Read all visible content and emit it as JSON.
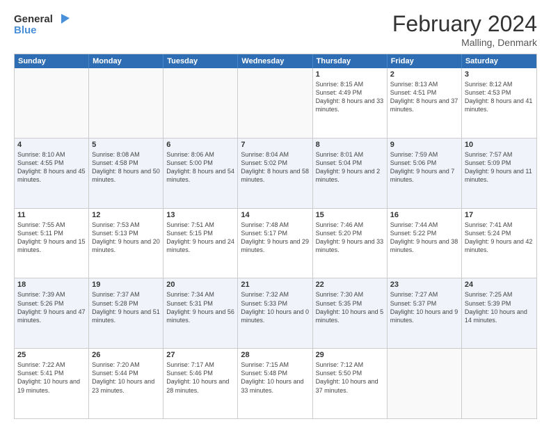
{
  "header": {
    "logo_line1": "General",
    "logo_line2": "Blue",
    "title": "February 2024",
    "subtitle": "Malling, Denmark"
  },
  "days_of_week": [
    "Sunday",
    "Monday",
    "Tuesday",
    "Wednesday",
    "Thursday",
    "Friday",
    "Saturday"
  ],
  "rows": [
    [
      {
        "day": "",
        "sunrise": "",
        "sunset": "",
        "daylight": ""
      },
      {
        "day": "",
        "sunrise": "",
        "sunset": "",
        "daylight": ""
      },
      {
        "day": "",
        "sunrise": "",
        "sunset": "",
        "daylight": ""
      },
      {
        "day": "",
        "sunrise": "",
        "sunset": "",
        "daylight": ""
      },
      {
        "day": "1",
        "sunrise": "Sunrise: 8:15 AM",
        "sunset": "Sunset: 4:49 PM",
        "daylight": "Daylight: 8 hours and 33 minutes."
      },
      {
        "day": "2",
        "sunrise": "Sunrise: 8:13 AM",
        "sunset": "Sunset: 4:51 PM",
        "daylight": "Daylight: 8 hours and 37 minutes."
      },
      {
        "day": "3",
        "sunrise": "Sunrise: 8:12 AM",
        "sunset": "Sunset: 4:53 PM",
        "daylight": "Daylight: 8 hours and 41 minutes."
      }
    ],
    [
      {
        "day": "4",
        "sunrise": "Sunrise: 8:10 AM",
        "sunset": "Sunset: 4:55 PM",
        "daylight": "Daylight: 8 hours and 45 minutes."
      },
      {
        "day": "5",
        "sunrise": "Sunrise: 8:08 AM",
        "sunset": "Sunset: 4:58 PM",
        "daylight": "Daylight: 8 hours and 50 minutes."
      },
      {
        "day": "6",
        "sunrise": "Sunrise: 8:06 AM",
        "sunset": "Sunset: 5:00 PM",
        "daylight": "Daylight: 8 hours and 54 minutes."
      },
      {
        "day": "7",
        "sunrise": "Sunrise: 8:04 AM",
        "sunset": "Sunset: 5:02 PM",
        "daylight": "Daylight: 8 hours and 58 minutes."
      },
      {
        "day": "8",
        "sunrise": "Sunrise: 8:01 AM",
        "sunset": "Sunset: 5:04 PM",
        "daylight": "Daylight: 9 hours and 2 minutes."
      },
      {
        "day": "9",
        "sunrise": "Sunrise: 7:59 AM",
        "sunset": "Sunset: 5:06 PM",
        "daylight": "Daylight: 9 hours and 7 minutes."
      },
      {
        "day": "10",
        "sunrise": "Sunrise: 7:57 AM",
        "sunset": "Sunset: 5:09 PM",
        "daylight": "Daylight: 9 hours and 11 minutes."
      }
    ],
    [
      {
        "day": "11",
        "sunrise": "Sunrise: 7:55 AM",
        "sunset": "Sunset: 5:11 PM",
        "daylight": "Daylight: 9 hours and 15 minutes."
      },
      {
        "day": "12",
        "sunrise": "Sunrise: 7:53 AM",
        "sunset": "Sunset: 5:13 PM",
        "daylight": "Daylight: 9 hours and 20 minutes."
      },
      {
        "day": "13",
        "sunrise": "Sunrise: 7:51 AM",
        "sunset": "Sunset: 5:15 PM",
        "daylight": "Daylight: 9 hours and 24 minutes."
      },
      {
        "day": "14",
        "sunrise": "Sunrise: 7:48 AM",
        "sunset": "Sunset: 5:17 PM",
        "daylight": "Daylight: 9 hours and 29 minutes."
      },
      {
        "day": "15",
        "sunrise": "Sunrise: 7:46 AM",
        "sunset": "Sunset: 5:20 PM",
        "daylight": "Daylight: 9 hours and 33 minutes."
      },
      {
        "day": "16",
        "sunrise": "Sunrise: 7:44 AM",
        "sunset": "Sunset: 5:22 PM",
        "daylight": "Daylight: 9 hours and 38 minutes."
      },
      {
        "day": "17",
        "sunrise": "Sunrise: 7:41 AM",
        "sunset": "Sunset: 5:24 PM",
        "daylight": "Daylight: 9 hours and 42 minutes."
      }
    ],
    [
      {
        "day": "18",
        "sunrise": "Sunrise: 7:39 AM",
        "sunset": "Sunset: 5:26 PM",
        "daylight": "Daylight: 9 hours and 47 minutes."
      },
      {
        "day": "19",
        "sunrise": "Sunrise: 7:37 AM",
        "sunset": "Sunset: 5:28 PM",
        "daylight": "Daylight: 9 hours and 51 minutes."
      },
      {
        "day": "20",
        "sunrise": "Sunrise: 7:34 AM",
        "sunset": "Sunset: 5:31 PM",
        "daylight": "Daylight: 9 hours and 56 minutes."
      },
      {
        "day": "21",
        "sunrise": "Sunrise: 7:32 AM",
        "sunset": "Sunset: 5:33 PM",
        "daylight": "Daylight: 10 hours and 0 minutes."
      },
      {
        "day": "22",
        "sunrise": "Sunrise: 7:30 AM",
        "sunset": "Sunset: 5:35 PM",
        "daylight": "Daylight: 10 hours and 5 minutes."
      },
      {
        "day": "23",
        "sunrise": "Sunrise: 7:27 AM",
        "sunset": "Sunset: 5:37 PM",
        "daylight": "Daylight: 10 hours and 9 minutes."
      },
      {
        "day": "24",
        "sunrise": "Sunrise: 7:25 AM",
        "sunset": "Sunset: 5:39 PM",
        "daylight": "Daylight: 10 hours and 14 minutes."
      }
    ],
    [
      {
        "day": "25",
        "sunrise": "Sunrise: 7:22 AM",
        "sunset": "Sunset: 5:41 PM",
        "daylight": "Daylight: 10 hours and 19 minutes."
      },
      {
        "day": "26",
        "sunrise": "Sunrise: 7:20 AM",
        "sunset": "Sunset: 5:44 PM",
        "daylight": "Daylight: 10 hours and 23 minutes."
      },
      {
        "day": "27",
        "sunrise": "Sunrise: 7:17 AM",
        "sunset": "Sunset: 5:46 PM",
        "daylight": "Daylight: 10 hours and 28 minutes."
      },
      {
        "day": "28",
        "sunrise": "Sunrise: 7:15 AM",
        "sunset": "Sunset: 5:48 PM",
        "daylight": "Daylight: 10 hours and 33 minutes."
      },
      {
        "day": "29",
        "sunrise": "Sunrise: 7:12 AM",
        "sunset": "Sunset: 5:50 PM",
        "daylight": "Daylight: 10 hours and 37 minutes."
      },
      {
        "day": "",
        "sunrise": "",
        "sunset": "",
        "daylight": ""
      },
      {
        "day": "",
        "sunrise": "",
        "sunset": "",
        "daylight": ""
      }
    ]
  ]
}
